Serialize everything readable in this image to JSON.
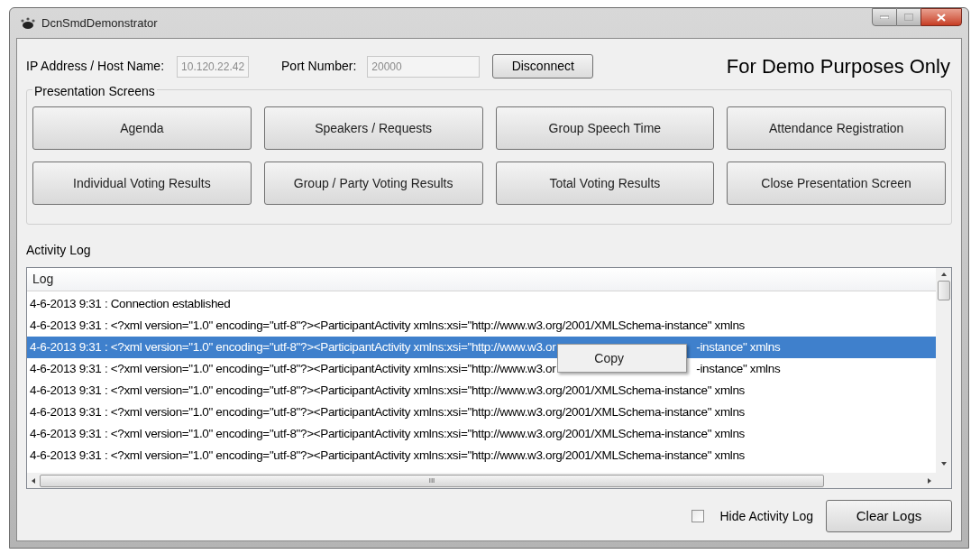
{
  "window": {
    "title": "DcnSmdDemonstrator"
  },
  "connection": {
    "ip_label": "IP Address / Host Name:",
    "ip_value": "10.120.22.42",
    "port_label": "Port Number:",
    "port_value": "20000",
    "disabled": true,
    "button": "Disconnect"
  },
  "banner": "For Demo Purposes Only",
  "presentation_screens": {
    "title": "Presentation Screens",
    "buttons": [
      "Agenda",
      "Speakers / Requests",
      "Group Speech Time",
      "Attendance Registration",
      "Individual Voting Results",
      "Group / Party Voting Results",
      "Total Voting Results",
      "Close Presentation Screen"
    ]
  },
  "activity_log": {
    "title": "Activity Log",
    "column": "Log",
    "rows": [
      {
        "text": "4-6-2013 9:31 : Connection established",
        "selected": false
      },
      {
        "text": "4-6-2013 9:31 : <?xml version=\"1.0\" encoding=\"utf-8\"?><ParticipantActivity xmlns:xsi=\"http://www.w3.org/2001/XMLSchema-instance\" xmlns",
        "selected": false
      },
      {
        "text": "4-6-2013 9:31 : <?xml version=\"1.0\" encoding=\"utf-8\"?><ParticipantActivity xmlns:xsi=\"http://www.w3.or",
        "text_after": "-instance\" xmlns",
        "selected": true
      },
      {
        "text": "4-6-2013 9:31 : <?xml version=\"1.0\" encoding=\"utf-8\"?><ParticipantActivity xmlns:xsi=\"http://www.w3.or",
        "text_after": "-instance\" xmlns",
        "selected": false
      },
      {
        "text": "4-6-2013 9:31 : <?xml version=\"1.0\" encoding=\"utf-8\"?><ParticipantActivity xmlns:xsi=\"http://www.w3.org/2001/XMLSchema-instance\" xmlns",
        "selected": false
      },
      {
        "text": "4-6-2013 9:31 : <?xml version=\"1.0\" encoding=\"utf-8\"?><ParticipantActivity xmlns:xsi=\"http://www.w3.org/2001/XMLSchema-instance\" xmlns",
        "selected": false
      },
      {
        "text": "4-6-2013 9:31 : <?xml version=\"1.0\" encoding=\"utf-8\"?><ParticipantActivity xmlns:xsi=\"http://www.w3.org/2001/XMLSchema-instance\" xmlns",
        "selected": false
      },
      {
        "text": "4-6-2013 9:31 : <?xml version=\"1.0\" encoding=\"utf-8\"?><ParticipantActivity xmlns:xsi=\"http://www.w3.org/2001/XMLSchema-instance\" xmlns",
        "selected": false
      }
    ],
    "scroll_glyph": "III"
  },
  "context_menu": {
    "items": [
      "Copy"
    ]
  },
  "hide_activity_log": {
    "label": "Hide Activity Log",
    "checked": false
  },
  "clear_button": "Clear Logs"
}
